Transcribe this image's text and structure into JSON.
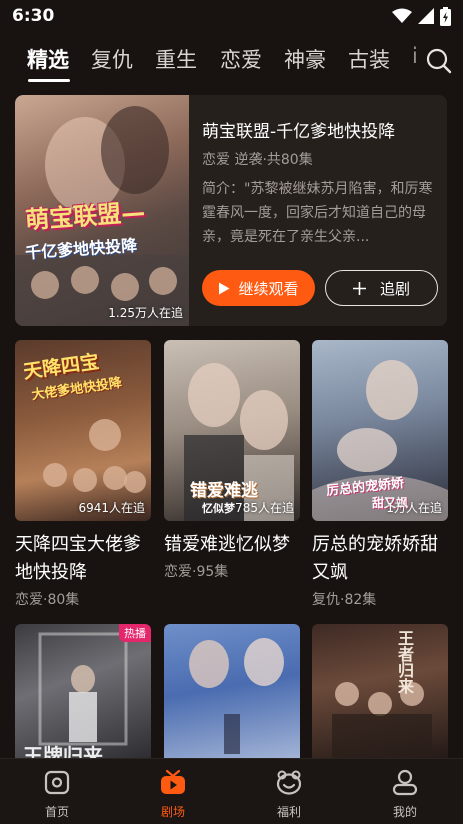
{
  "status": {
    "time": "6:30"
  },
  "tabs": [
    {
      "label": "精选"
    },
    {
      "label": "复仇"
    },
    {
      "label": "重生"
    },
    {
      "label": "恋爱"
    },
    {
      "label": "神豪"
    },
    {
      "label": "古装"
    },
    {
      "label": "i"
    }
  ],
  "featured": {
    "title": "萌宝联盟-千亿爹地快投降",
    "meta": "恋爱 逆袭·共80集",
    "description": "简介：\"苏黎被继妹苏月陷害，和厉寒霆春风一度，回家后才知道自己的母亲，竟是死在了亲生父亲...",
    "poster_title_big": "萌宝联盟—",
    "poster_title_small": "千亿爹地快投降",
    "viewers": "1.25万人在追",
    "watch_label": "继续观看",
    "follow_label": "追剧"
  },
  "grid": [
    {
      "title": "天降四宝大佬爹地快投降",
      "meta": "恋爱·80集",
      "viewers": "6941人在追",
      "art_big": "天降四宝",
      "art_small": "大佬爹地快投降"
    },
    {
      "title": "错爱难逃忆似梦",
      "meta": "恋爱·95集",
      "viewers": "785人在追",
      "art_big": "错爱难逃",
      "art_small": "忆似梦"
    },
    {
      "title": "厉总的宠娇娇甜又飒",
      "meta": "复仇·82集",
      "viewers": "1万人在追",
      "art_big": "厉总的宠娇娇",
      "art_small": "甜又飒"
    }
  ],
  "grid_row2": [
    {
      "badge": "热播",
      "art": "王牌归来"
    },
    {
      "badge": "",
      "art": ""
    },
    {
      "badge": "",
      "art": "王者归来"
    }
  ],
  "nav": [
    {
      "label": "首页"
    },
    {
      "label": "剧场"
    },
    {
      "label": "福利"
    },
    {
      "label": "我的"
    }
  ],
  "colors": {
    "accent": "#ff5a12",
    "background": "#181311",
    "card": "#26201d",
    "meta": "#a39c97"
  }
}
